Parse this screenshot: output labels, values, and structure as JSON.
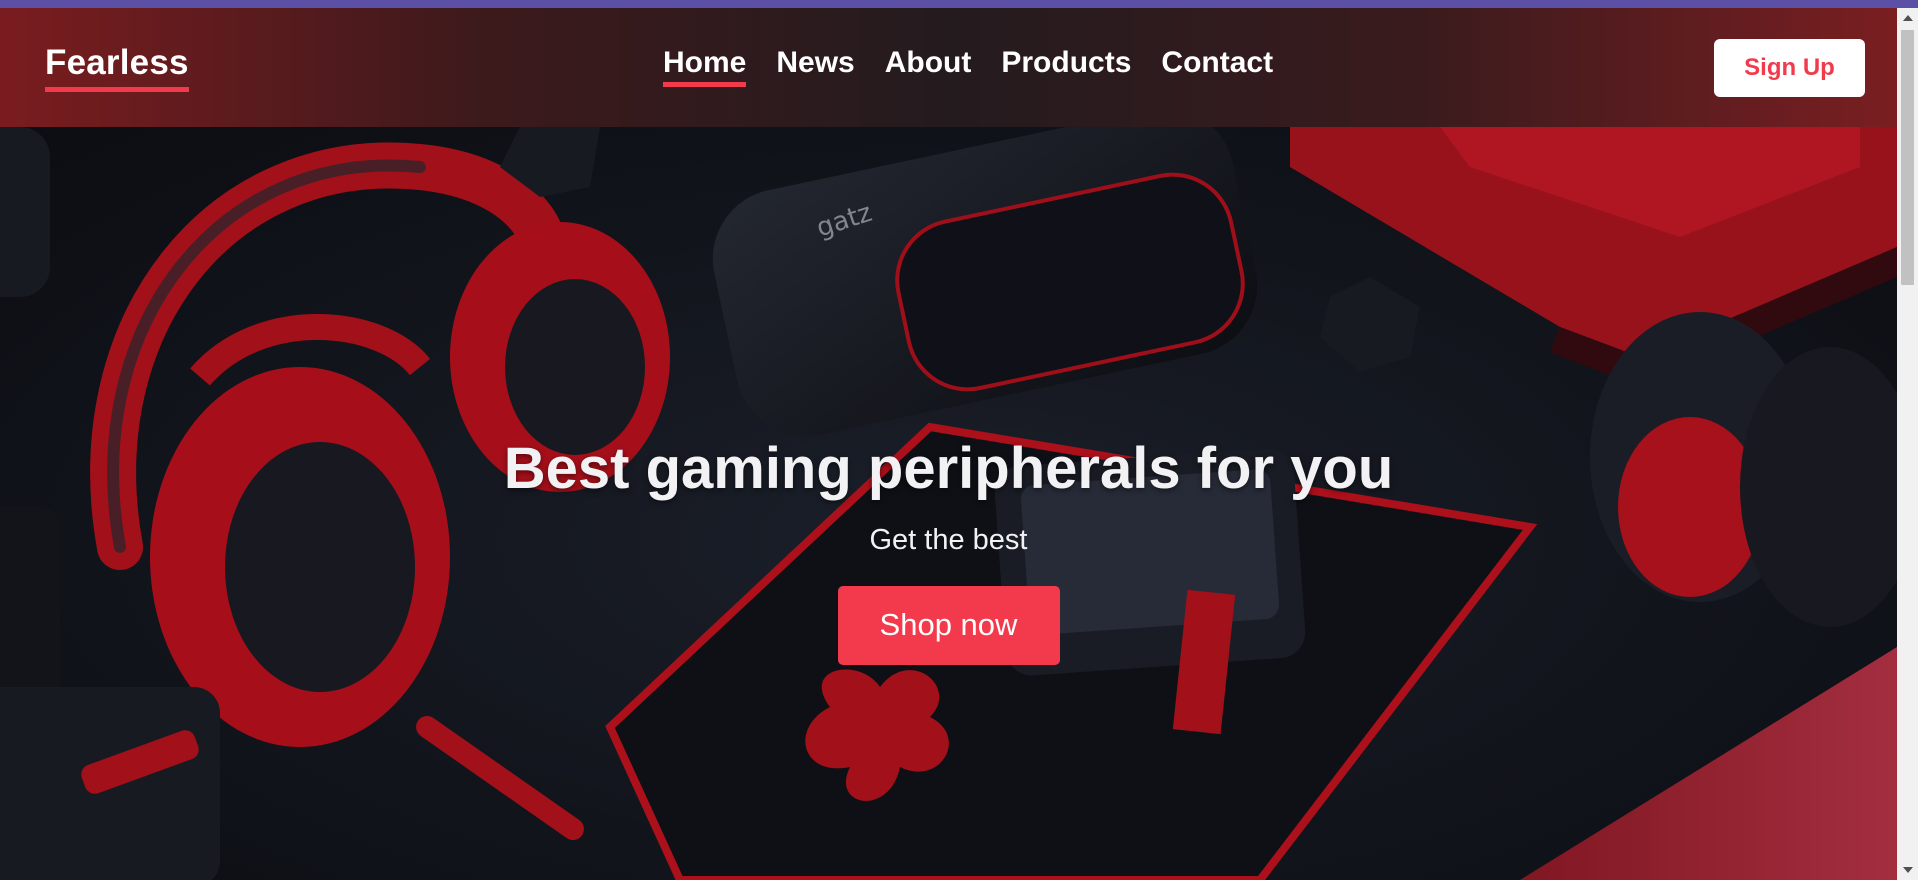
{
  "brand": {
    "name": "Fearless",
    "accent_color": "#f23a4c"
  },
  "nav": {
    "items": [
      {
        "label": "Home",
        "active": true
      },
      {
        "label": "News",
        "active": false
      },
      {
        "label": "About",
        "active": false
      },
      {
        "label": "Products",
        "active": false
      },
      {
        "label": "Contact",
        "active": false
      }
    ],
    "signup_label": "Sign Up"
  },
  "hero": {
    "title": "Best gaming peripherals for you",
    "subtitle": "Get the best",
    "cta_label": "Shop now",
    "background_image": "gaming-peripherals-photo"
  },
  "scrollbar": {
    "up_icon": "chevron-up-icon",
    "down_icon": "chevron-down-icon"
  }
}
